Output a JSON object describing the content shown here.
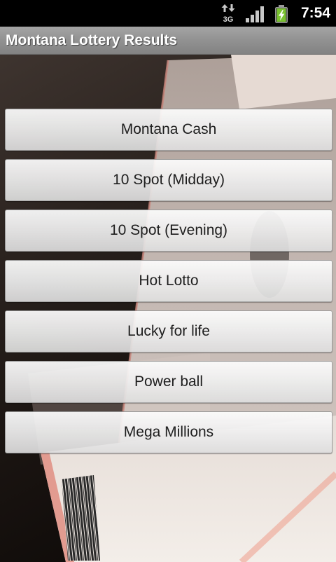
{
  "status_bar": {
    "data_icon": "3g-data-icon",
    "network_label": "3G",
    "signal_icon": "signal-bars-icon",
    "signal_bars": 4,
    "battery_icon": "battery-charging-icon",
    "battery_level": 1.0,
    "time": "7:54"
  },
  "title_bar": {
    "title": "Montana Lottery Results"
  },
  "games": [
    {
      "label": "Montana Cash"
    },
    {
      "label": "10 Spot (Midday)"
    },
    {
      "label": "10 Spot (Evening)"
    },
    {
      "label": "Hot Lotto"
    },
    {
      "label": "Lucky for life"
    },
    {
      "label": "Power ball"
    },
    {
      "label": "Mega Millions"
    }
  ],
  "colors": {
    "status_bar_bg": "#000000",
    "title_bar_bg": "#8c8c8c",
    "title_text": "#ffffff",
    "button_text": "#1e1e1e",
    "battery_fill": "#7ac231"
  }
}
